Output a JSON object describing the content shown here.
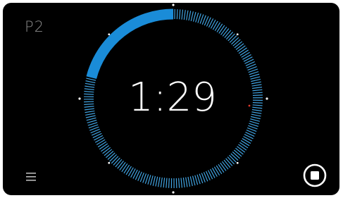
{
  "profile": {
    "label": "P2"
  },
  "timer": {
    "display": "1:29",
    "progress_fraction": 0.79
  },
  "colors": {
    "background": "#000000",
    "arc_solid": "#1a8cd8",
    "arc_ticks": "#45aef0",
    "text": "#ffffff",
    "marker": "#ffffff",
    "accent_dot": "#e0392c"
  },
  "icons": {
    "menu": "hamburger-menu-icon",
    "stop": "stop-circle-icon"
  }
}
